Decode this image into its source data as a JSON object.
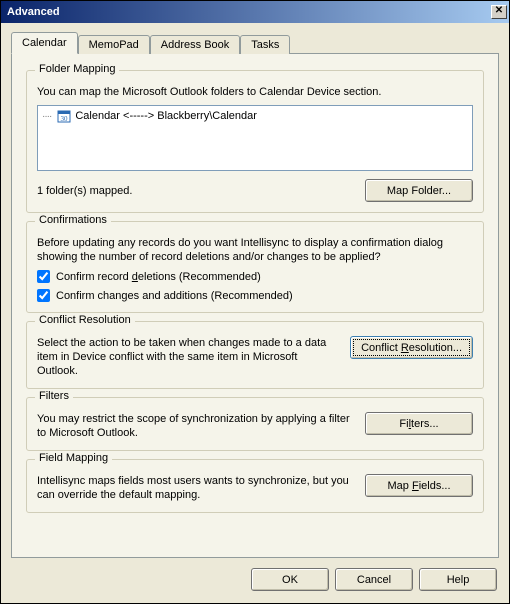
{
  "window": {
    "title": "Advanced"
  },
  "tabs": {
    "items": [
      "Calendar",
      "MemoPad",
      "Address Book",
      "Tasks"
    ],
    "active": 0
  },
  "folderMapping": {
    "legend": "Folder Mapping",
    "desc": "You can map the Microsoft Outlook folders to Calendar Device section.",
    "item": "Calendar <-----> Blackberry\\Calendar",
    "status": "1 folder(s) mapped.",
    "button": "Map Folder..."
  },
  "confirmations": {
    "legend": "Confirmations",
    "desc": "Before updating any records do you want Intellisync to display a confirmation dialog showing the number of record deletions and/or changes to be applied?",
    "chk1_pre": "Confirm record ",
    "chk1_u": "d",
    "chk1_post": "eletions (Recommended)",
    "chk2_pre": "Confirm chan",
    "chk2_u": "g",
    "chk2_post": "es and additions (Recommended)"
  },
  "conflict": {
    "legend": "Conflict Resolution",
    "desc": "Select the action to be taken when changes made to a data item in Device conflict with the same item in Microsoft Outlook.",
    "btn_pre": "Conflict ",
    "btn_u": "R",
    "btn_post": "esolution..."
  },
  "filters": {
    "legend": "Filters",
    "desc": "You may restrict the scope of synchronization by applying a filter to Microsoft Outlook.",
    "btn_pre": "Fi",
    "btn_u": "l",
    "btn_post": "ters..."
  },
  "fieldMapping": {
    "legend": "Field Mapping",
    "desc": "Intellisync maps fields most users wants to synchronize, but you can override the default mapping.",
    "btn_pre": "Map ",
    "btn_u": "F",
    "btn_post": "ields..."
  },
  "footer": {
    "ok": "OK",
    "cancel": "Cancel",
    "help": "Help"
  }
}
